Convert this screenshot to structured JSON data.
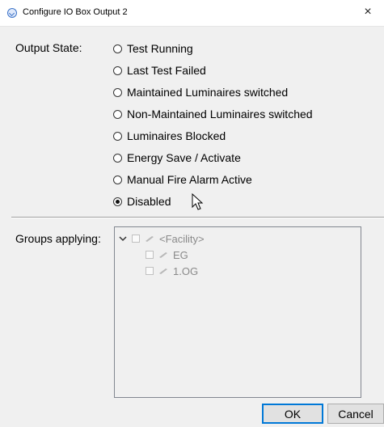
{
  "window": {
    "title": "Configure IO Box Output 2",
    "close_label": "×"
  },
  "output_state": {
    "label": "Output State:",
    "options": [
      {
        "label": "Test Running",
        "checked": false
      },
      {
        "label": "Last Test Failed",
        "checked": false
      },
      {
        "label": "Maintained Luminaires switched",
        "checked": false
      },
      {
        "label": "Non-Maintained Luminaires switched",
        "checked": false
      },
      {
        "label": "Luminaires Blocked",
        "checked": false
      },
      {
        "label": "Energy Save / Activate",
        "checked": false
      },
      {
        "label": "Manual Fire Alarm Active",
        "checked": false
      },
      {
        "label": "Disabled",
        "checked": true
      }
    ]
  },
  "groups": {
    "label": "Groups applying:",
    "tree": [
      {
        "label": "<Facility>",
        "expanded": true,
        "checked": false,
        "children": [
          {
            "label": "EG",
            "checked": false
          },
          {
            "label": "1.OG",
            "checked": false
          }
        ]
      }
    ]
  },
  "buttons": {
    "ok_label": "OK",
    "cancel_label": "Cancel"
  },
  "colors": {
    "accent": "#0078d7",
    "disabled_text": "#8a8a8a",
    "window_bg": "#f0f0f0"
  }
}
